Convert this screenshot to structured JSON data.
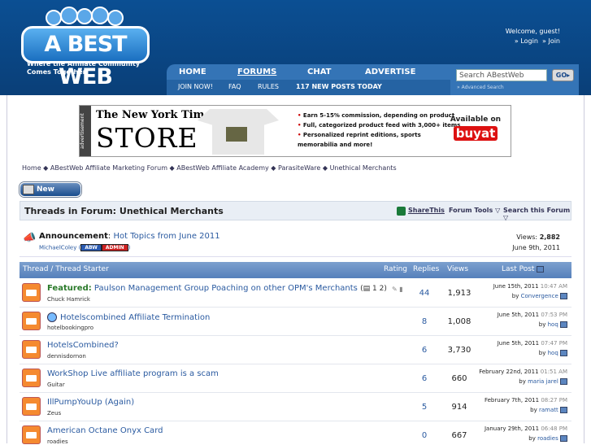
{
  "header": {
    "logo_text": "A BEST WEB",
    "tagline": "Where the Affiliate Community Comes Together",
    "welcome": "Welcome, guest!",
    "login": "Login",
    "join": "Join"
  },
  "nav": {
    "main": [
      "HOME",
      "FORUMS",
      "CHAT",
      "ADVERTISE"
    ],
    "sub": [
      "JOIN NOW!",
      "FAQ",
      "RULES",
      "117 NEW POSTS TODAY"
    ]
  },
  "search": {
    "placeholder": "Search ABestWeb",
    "go": "GO",
    "advanced": "» Advanced Search"
  },
  "ad": {
    "side": "advertisement",
    "brand": "The New York Times",
    "store": "STORE",
    "bullets": [
      "Earn 5-15% commission, depending on product",
      "Full, categorized product feed with 3,000+ items",
      "Personalized reprint editions, sports memorabilia and more!"
    ],
    "available": "Available on",
    "buyat": "buyat"
  },
  "breadcrumb": [
    "Home",
    "ABestWeb Affiliate Marketing Forum",
    "ABestWeb Affiliate Academy",
    "ParasiteWare",
    "Unethical Merchants"
  ],
  "new_thread": "New Thread",
  "title_bar": {
    "title": "Threads in Forum: Unethical Merchants",
    "share": "ShareThis",
    "tools": "Forum Tools",
    "search": "Search this Forum"
  },
  "announcement": {
    "label": "Announcement",
    "title": "Hot Topics from June 2011",
    "user": "MichaelColey",
    "badges": [
      "ABW",
      "ADMIN"
    ],
    "views_label": "Views:",
    "views": "2,882",
    "date": "June 9th, 2011"
  },
  "table_header": {
    "thread": "Thread / Thread Starter",
    "rating": "Rating",
    "replies": "Replies",
    "views": "Views",
    "last_post": "Last Post"
  },
  "threads": [
    {
      "featured": "Featured:",
      "title": "Paulson Management Group Poaching on other OPM's Merchants",
      "pages": "1 2",
      "author": "Chuck Hamrick",
      "replies": "44",
      "views": "1,913",
      "date": "June 15th, 2011",
      "time": "10:47 AM",
      "last_by": "Convergence"
    },
    {
      "featured": "",
      "title": "Hotelscombined Affiliate Termination",
      "pages": "",
      "author": "hotelbookingpro",
      "replies": "8",
      "views": "1,008",
      "date": "June 5th, 2011",
      "time": "07:53 PM",
      "last_by": "hoq"
    },
    {
      "featured": "",
      "title": "HotelsCombined?",
      "pages": "",
      "author": "dennisdornon",
      "replies": "6",
      "views": "3,730",
      "date": "June 5th, 2011",
      "time": "07:47 PM",
      "last_by": "hoq"
    },
    {
      "featured": "",
      "title": "WorkShop Live affiliate program is a scam",
      "pages": "",
      "author": "Guitar",
      "replies": "6",
      "views": "660",
      "date": "February 22nd, 2011",
      "time": "01:51 AM",
      "last_by": "maria jarel"
    },
    {
      "featured": "",
      "title": "IllPumpYouUp (Again)",
      "pages": "",
      "author": "Zeus",
      "replies": "5",
      "views": "914",
      "date": "February 7th, 2011",
      "time": "08:27 PM",
      "last_by": "ramatt"
    },
    {
      "featured": "",
      "title": "American Octane Onyx Card",
      "pages": "",
      "author": "roadies",
      "replies": "0",
      "views": "667",
      "date": "January 29th, 2011",
      "time": "06:48 PM",
      "last_by": "roadies"
    }
  ],
  "by": "by"
}
